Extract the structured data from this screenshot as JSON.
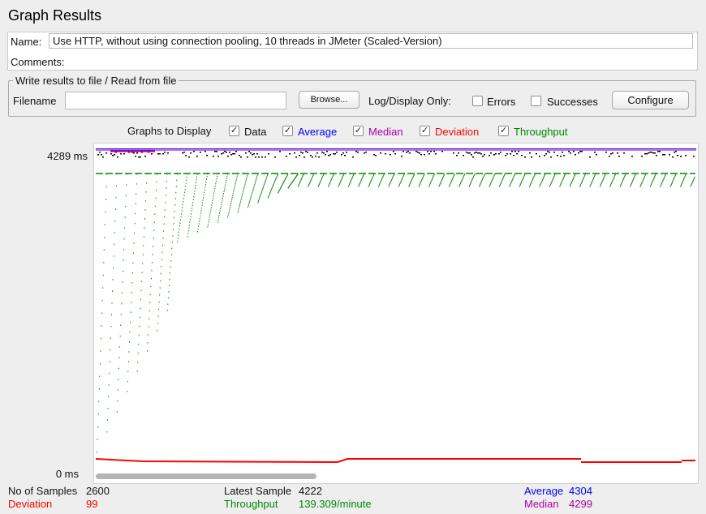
{
  "panel_title": "Graph Results",
  "name_label": "Name:",
  "name_value": "Use HTTP, without using connection pooling, 10 threads in JMeter (Scaled-Version)",
  "comments_label": "Comments:",
  "file_group": {
    "legend": "Write results to file / Read from file",
    "filename_label": "Filename",
    "filename_value": "",
    "browse_label": "Browse...",
    "log_display_label": "Log/Display Only:",
    "errors_label": "Errors",
    "errors_checked": false,
    "successes_label": "Successes",
    "successes_checked": false,
    "configure_label": "Configure"
  },
  "graphs": {
    "label": "Graphs to Display",
    "items": [
      {
        "label": "Data",
        "checked": true,
        "color": "#000000"
      },
      {
        "label": "Average",
        "checked": true,
        "color": "#0000ff"
      },
      {
        "label": "Median",
        "checked": true,
        "color": "#aa00aa"
      },
      {
        "label": "Deviation",
        "checked": true,
        "color": "#ff0000"
      },
      {
        "label": "Throughput",
        "checked": true,
        "color": "#008800"
      }
    ],
    "check_glyph": "✓"
  },
  "axis": {
    "y_max_label": "4289 ms",
    "y_min_label": "0 ms"
  },
  "stats": {
    "samples_label": "No of Samples",
    "samples_value": "2600",
    "latest_label": "Latest Sample",
    "latest_value": "4222",
    "average_label": "Average",
    "average_value": "4304",
    "deviation_label": "Deviation",
    "deviation_value": "99",
    "throughput_label": "Throughput",
    "throughput_value": "139.309/minute",
    "median_label": "Median",
    "median_value": "4299"
  },
  "chart_data": {
    "type": "scatter",
    "ylim": [
      0,
      4289
    ],
    "samples": 2600,
    "series": [
      {
        "name": "Data",
        "color": "#000000",
        "approx_level": 4289
      },
      {
        "name": "Average",
        "color": "#0000ff",
        "approx_level": 4304
      },
      {
        "name": "Median",
        "color": "#aa00aa",
        "approx_level": 4299
      },
      {
        "name": "Deviation",
        "color": "#ff0000",
        "approx_level": 99
      },
      {
        "name": "Throughput",
        "color": "#008800",
        "final_value_per_minute": 139.309
      }
    ]
  }
}
